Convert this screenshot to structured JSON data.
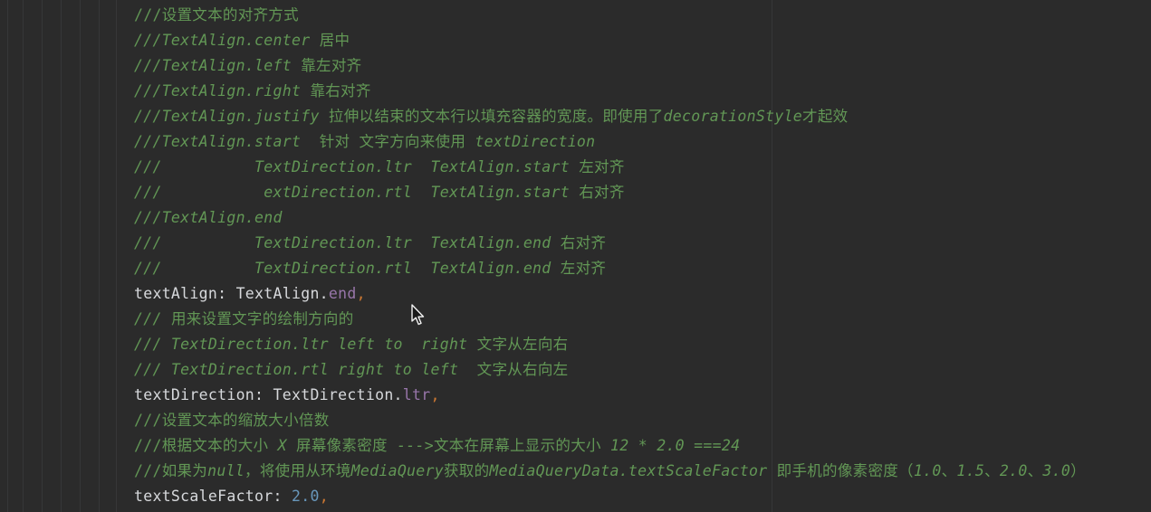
{
  "editor": {
    "lines": [
      {
        "type": "comment",
        "parts": [
          {
            "t": "///设置文本的对齐方式",
            "i": false
          }
        ]
      },
      {
        "type": "comment",
        "parts": [
          {
            "t": "///TextAlign.center ",
            "i": true
          },
          {
            "t": "居中",
            "i": false
          }
        ]
      },
      {
        "type": "comment",
        "parts": [
          {
            "t": "///TextAlign.left ",
            "i": true
          },
          {
            "t": "靠左对齐",
            "i": false
          }
        ]
      },
      {
        "type": "comment",
        "parts": [
          {
            "t": "///TextAlign.right ",
            "i": true
          },
          {
            "t": "靠右对齐",
            "i": false
          }
        ]
      },
      {
        "type": "comment",
        "parts": [
          {
            "t": "///TextAlign.justify ",
            "i": true
          },
          {
            "t": "拉伸以结束的文本行以填充容器的宽度。即使用了",
            "i": false
          },
          {
            "t": "decorationStyle",
            "i": true
          },
          {
            "t": "才起效",
            "i": false
          }
        ]
      },
      {
        "type": "comment",
        "parts": [
          {
            "t": "///TextAlign.start  ",
            "i": true
          },
          {
            "t": "针对 文字方向来使用 ",
            "i": false
          },
          {
            "t": "textDirection",
            "i": true
          }
        ]
      },
      {
        "type": "comment",
        "parts": [
          {
            "t": "///          TextDirection.ltr  TextAlign.start ",
            "i": true
          },
          {
            "t": "左对齐",
            "i": false
          }
        ]
      },
      {
        "type": "comment",
        "parts": [
          {
            "t": "///           extDirection.rtl  TextAlign.start ",
            "i": true
          },
          {
            "t": "右对齐",
            "i": false
          }
        ]
      },
      {
        "type": "comment",
        "parts": [
          {
            "t": "///TextAlign.end",
            "i": true
          }
        ]
      },
      {
        "type": "comment",
        "parts": [
          {
            "t": "///          TextDirection.ltr  TextAlign.end ",
            "i": true
          },
          {
            "t": "右对齐",
            "i": false
          }
        ]
      },
      {
        "type": "comment",
        "parts": [
          {
            "t": "///          TextDirection.rtl  TextAlign.end ",
            "i": true
          },
          {
            "t": "左对齐",
            "i": false
          }
        ]
      },
      {
        "type": "code",
        "parts": [
          {
            "t": "textAlign: ",
            "c": "prop"
          },
          {
            "t": "TextAlign.",
            "c": "prop"
          },
          {
            "t": "end",
            "c": "field"
          },
          {
            "t": ",",
            "c": "punc"
          }
        ]
      },
      {
        "type": "comment",
        "parts": [
          {
            "t": "/// ",
            "i": true
          },
          {
            "t": "用来设置文字的绘制方向的",
            "i": false
          }
        ]
      },
      {
        "type": "comment",
        "parts": [
          {
            "t": "/// TextDirection.ltr left to  right ",
            "i": true
          },
          {
            "t": "文字从左向右",
            "i": false
          }
        ]
      },
      {
        "type": "comment",
        "parts": [
          {
            "t": "/// TextDirection.rtl right to left  ",
            "i": true
          },
          {
            "t": "文字从右向左",
            "i": false
          }
        ]
      },
      {
        "type": "code",
        "parts": [
          {
            "t": "textDirection: ",
            "c": "prop"
          },
          {
            "t": "TextDirection.",
            "c": "prop"
          },
          {
            "t": "ltr",
            "c": "field"
          },
          {
            "t": ",",
            "c": "punc"
          }
        ]
      },
      {
        "type": "comment",
        "parts": [
          {
            "t": "///设置文本的缩放大小倍数",
            "i": false
          }
        ]
      },
      {
        "type": "comment",
        "parts": [
          {
            "t": "///根据文本的大小 ",
            "i": false
          },
          {
            "t": "X ",
            "i": true
          },
          {
            "t": "屏幕像素密度 ",
            "i": false
          },
          {
            "t": "--->",
            "i": true
          },
          {
            "t": "文本在屏幕上显示的大小 ",
            "i": false
          },
          {
            "t": "12 * 2.0 ===24",
            "i": true
          }
        ]
      },
      {
        "type": "comment",
        "parts": [
          {
            "t": "///如果为",
            "i": false
          },
          {
            "t": "null",
            "i": true
          },
          {
            "t": "，将使用从环境",
            "i": false
          },
          {
            "t": "MediaQuery",
            "i": true
          },
          {
            "t": "获取的",
            "i": false
          },
          {
            "t": "MediaQueryData.textScaleFactor ",
            "i": true
          },
          {
            "t": "即手机的像素密度（",
            "i": false
          },
          {
            "t": "1.0",
            "i": true
          },
          {
            "t": "、",
            "i": false
          },
          {
            "t": "1.5",
            "i": true
          },
          {
            "t": "、",
            "i": false
          },
          {
            "t": "2.0",
            "i": true
          },
          {
            "t": "、",
            "i": false
          },
          {
            "t": "3.0",
            "i": true
          },
          {
            "t": "）",
            "i": false
          }
        ]
      },
      {
        "type": "code",
        "parts": [
          {
            "t": "textScaleFactor: ",
            "c": "prop"
          },
          {
            "t": "2.0",
            "c": "num"
          },
          {
            "t": ",",
            "c": "punc"
          }
        ]
      }
    ]
  },
  "colors": {
    "background": "#2b2b2b",
    "comment": "#629755",
    "identifier": "#d7d9dc",
    "field": "#9876aa",
    "number": "#6897bb",
    "punctuation": "#cc7832"
  },
  "cursor": {
    "icon": "mouse-pointer-icon"
  }
}
